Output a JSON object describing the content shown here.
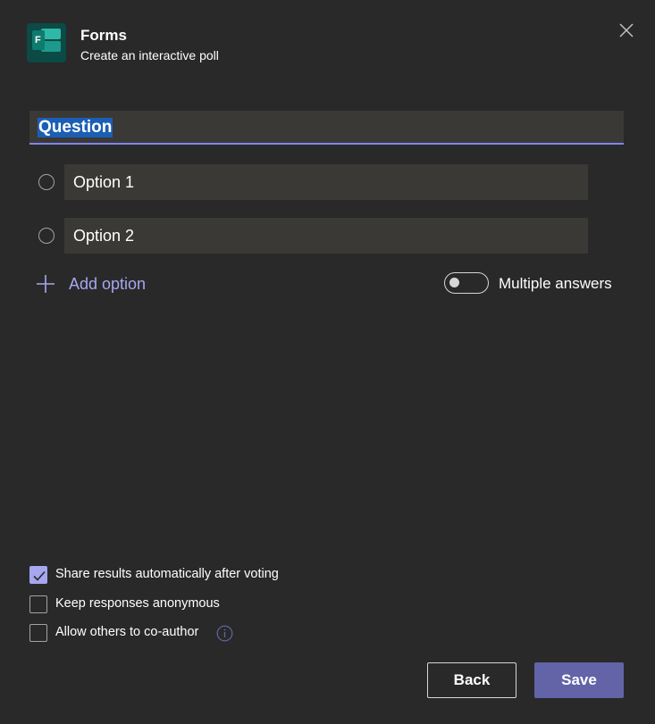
{
  "header": {
    "app_name": "Forms",
    "subtitle": "Create an interactive poll",
    "icon": "microsoft-forms-icon",
    "icon_letter": "F"
  },
  "question": {
    "value": "Question",
    "selected": true
  },
  "options": [
    {
      "value": "Option 1"
    },
    {
      "value": "Option 2"
    }
  ],
  "add_option_label": "Add option",
  "multiple_answers": {
    "label": "Multiple answers",
    "enabled": false
  },
  "settings": [
    {
      "label": "Share results automatically after voting",
      "checked": true
    },
    {
      "label": "Keep responses anonymous",
      "checked": false
    },
    {
      "label": "Allow others to co-author",
      "checked": false,
      "has_info_icon": true
    }
  ],
  "buttons": {
    "back": "Back",
    "save": "Save"
  },
  "colors": {
    "background": "#292929",
    "field_background": "#3b3936",
    "accent": "#6264a7",
    "accent_light": "#a6a7f0",
    "selection": "#1b5fb4"
  }
}
